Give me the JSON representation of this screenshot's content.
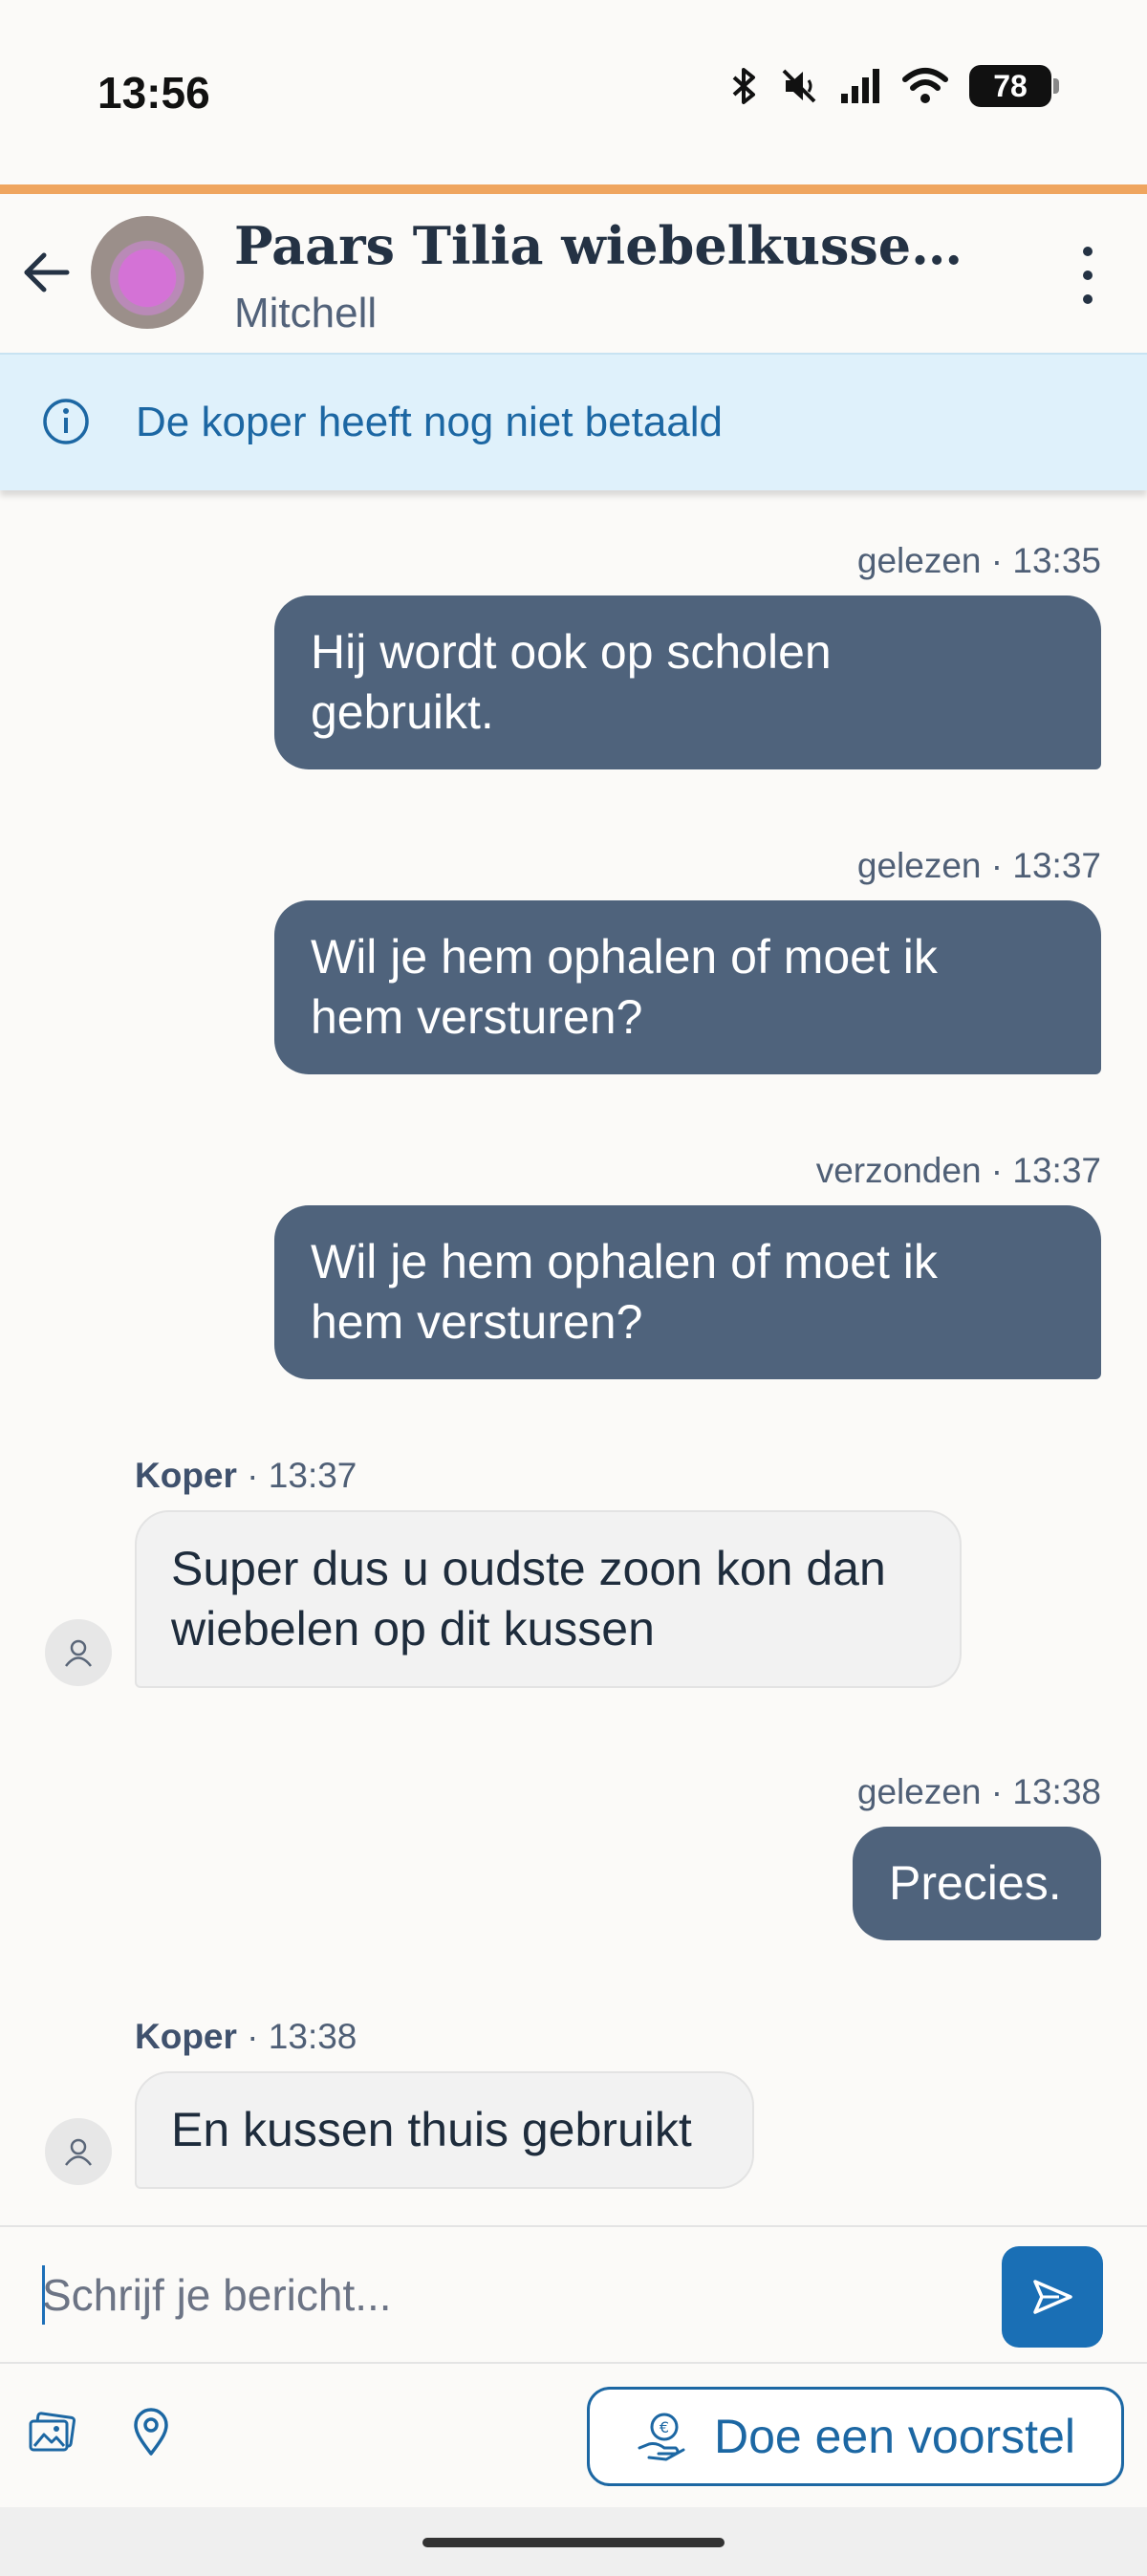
{
  "status_bar": {
    "time": "13:56",
    "battery": "78"
  },
  "header": {
    "title": "Paars Tilia wiebelkussen. Id...",
    "subtitle": "Mitchell"
  },
  "banner": {
    "text": "De koper heeft nog niet betaald"
  },
  "messages": [
    {
      "direction": "out",
      "meta": "gelezen · 13:35",
      "text_lines": [
        "Hij wordt ook op scholen",
        "gebruikt."
      ]
    },
    {
      "direction": "out",
      "meta": "gelezen · 13:37",
      "text_lines": [
        "Wil je hem ophalen of moet ik",
        "hem versturen?"
      ]
    },
    {
      "direction": "out",
      "meta": "verzonden · 13:37",
      "text_lines": [
        "Wil je hem ophalen of moet ik",
        "hem versturen?"
      ]
    },
    {
      "direction": "in",
      "sender": "Koper",
      "time": " · 13:37",
      "text_lines": [
        "Super dus u oudste zoon kon dan",
        "wiebelen op dit kussen"
      ]
    },
    {
      "direction": "out",
      "meta": "gelezen · 13:38",
      "text_lines": [
        "Precies."
      ]
    },
    {
      "direction": "in",
      "sender": "Koper",
      "time": " · 13:38",
      "text_lines": [
        "En kussen thuis gebruikt"
      ]
    }
  ],
  "composer": {
    "placeholder": "Schrijf je bericht..."
  },
  "toolbar": {
    "offer_label": "Doe een voorstel"
  },
  "colors": {
    "accent": "#efa55f",
    "outgoing_bubble": "#4f637c",
    "primary": "#1c67a3",
    "banner_bg": "#dff1fb"
  }
}
